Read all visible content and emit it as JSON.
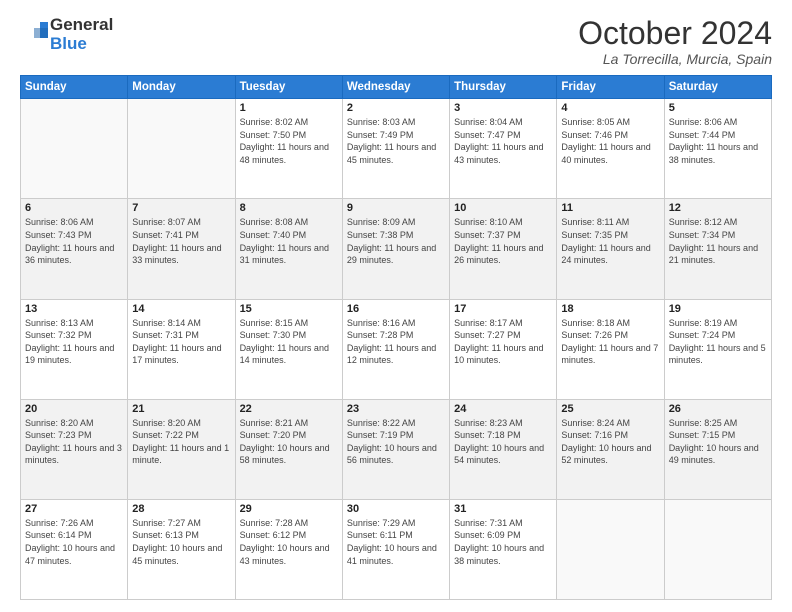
{
  "header": {
    "logo_line1": "General",
    "logo_line2": "Blue",
    "month": "October 2024",
    "location": "La Torrecilla, Murcia, Spain"
  },
  "days_of_week": [
    "Sunday",
    "Monday",
    "Tuesday",
    "Wednesday",
    "Thursday",
    "Friday",
    "Saturday"
  ],
  "weeks": [
    [
      {
        "num": "",
        "info": ""
      },
      {
        "num": "",
        "info": ""
      },
      {
        "num": "1",
        "info": "Sunrise: 8:02 AM\nSunset: 7:50 PM\nDaylight: 11 hours and 48 minutes."
      },
      {
        "num": "2",
        "info": "Sunrise: 8:03 AM\nSunset: 7:49 PM\nDaylight: 11 hours and 45 minutes."
      },
      {
        "num": "3",
        "info": "Sunrise: 8:04 AM\nSunset: 7:47 PM\nDaylight: 11 hours and 43 minutes."
      },
      {
        "num": "4",
        "info": "Sunrise: 8:05 AM\nSunset: 7:46 PM\nDaylight: 11 hours and 40 minutes."
      },
      {
        "num": "5",
        "info": "Sunrise: 8:06 AM\nSunset: 7:44 PM\nDaylight: 11 hours and 38 minutes."
      }
    ],
    [
      {
        "num": "6",
        "info": "Sunrise: 8:06 AM\nSunset: 7:43 PM\nDaylight: 11 hours and 36 minutes."
      },
      {
        "num": "7",
        "info": "Sunrise: 8:07 AM\nSunset: 7:41 PM\nDaylight: 11 hours and 33 minutes."
      },
      {
        "num": "8",
        "info": "Sunrise: 8:08 AM\nSunset: 7:40 PM\nDaylight: 11 hours and 31 minutes."
      },
      {
        "num": "9",
        "info": "Sunrise: 8:09 AM\nSunset: 7:38 PM\nDaylight: 11 hours and 29 minutes."
      },
      {
        "num": "10",
        "info": "Sunrise: 8:10 AM\nSunset: 7:37 PM\nDaylight: 11 hours and 26 minutes."
      },
      {
        "num": "11",
        "info": "Sunrise: 8:11 AM\nSunset: 7:35 PM\nDaylight: 11 hours and 24 minutes."
      },
      {
        "num": "12",
        "info": "Sunrise: 8:12 AM\nSunset: 7:34 PM\nDaylight: 11 hours and 21 minutes."
      }
    ],
    [
      {
        "num": "13",
        "info": "Sunrise: 8:13 AM\nSunset: 7:32 PM\nDaylight: 11 hours and 19 minutes."
      },
      {
        "num": "14",
        "info": "Sunrise: 8:14 AM\nSunset: 7:31 PM\nDaylight: 11 hours and 17 minutes."
      },
      {
        "num": "15",
        "info": "Sunrise: 8:15 AM\nSunset: 7:30 PM\nDaylight: 11 hours and 14 minutes."
      },
      {
        "num": "16",
        "info": "Sunrise: 8:16 AM\nSunset: 7:28 PM\nDaylight: 11 hours and 12 minutes."
      },
      {
        "num": "17",
        "info": "Sunrise: 8:17 AM\nSunset: 7:27 PM\nDaylight: 11 hours and 10 minutes."
      },
      {
        "num": "18",
        "info": "Sunrise: 8:18 AM\nSunset: 7:26 PM\nDaylight: 11 hours and 7 minutes."
      },
      {
        "num": "19",
        "info": "Sunrise: 8:19 AM\nSunset: 7:24 PM\nDaylight: 11 hours and 5 minutes."
      }
    ],
    [
      {
        "num": "20",
        "info": "Sunrise: 8:20 AM\nSunset: 7:23 PM\nDaylight: 11 hours and 3 minutes."
      },
      {
        "num": "21",
        "info": "Sunrise: 8:20 AM\nSunset: 7:22 PM\nDaylight: 11 hours and 1 minute."
      },
      {
        "num": "22",
        "info": "Sunrise: 8:21 AM\nSunset: 7:20 PM\nDaylight: 10 hours and 58 minutes."
      },
      {
        "num": "23",
        "info": "Sunrise: 8:22 AM\nSunset: 7:19 PM\nDaylight: 10 hours and 56 minutes."
      },
      {
        "num": "24",
        "info": "Sunrise: 8:23 AM\nSunset: 7:18 PM\nDaylight: 10 hours and 54 minutes."
      },
      {
        "num": "25",
        "info": "Sunrise: 8:24 AM\nSunset: 7:16 PM\nDaylight: 10 hours and 52 minutes."
      },
      {
        "num": "26",
        "info": "Sunrise: 8:25 AM\nSunset: 7:15 PM\nDaylight: 10 hours and 49 minutes."
      }
    ],
    [
      {
        "num": "27",
        "info": "Sunrise: 7:26 AM\nSunset: 6:14 PM\nDaylight: 10 hours and 47 minutes."
      },
      {
        "num": "28",
        "info": "Sunrise: 7:27 AM\nSunset: 6:13 PM\nDaylight: 10 hours and 45 minutes."
      },
      {
        "num": "29",
        "info": "Sunrise: 7:28 AM\nSunset: 6:12 PM\nDaylight: 10 hours and 43 minutes."
      },
      {
        "num": "30",
        "info": "Sunrise: 7:29 AM\nSunset: 6:11 PM\nDaylight: 10 hours and 41 minutes."
      },
      {
        "num": "31",
        "info": "Sunrise: 7:31 AM\nSunset: 6:09 PM\nDaylight: 10 hours and 38 minutes."
      },
      {
        "num": "",
        "info": ""
      },
      {
        "num": "",
        "info": ""
      }
    ]
  ]
}
